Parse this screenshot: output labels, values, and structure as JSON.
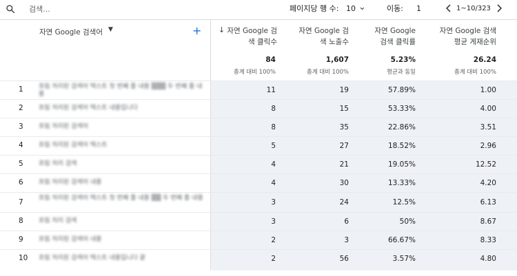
{
  "search": {
    "placeholder": "검색..."
  },
  "pagination": {
    "rows_label": "페이지당 행 수:",
    "rows_value": "10",
    "goto_label": "이동:",
    "goto_value": "1",
    "range": "1~10/323"
  },
  "columns": {
    "query": "자연 Google 검색어",
    "clicks": [
      "자연 Google 검",
      "색 클릭수"
    ],
    "impressions": [
      "자연 Google 검",
      "색 노출수"
    ],
    "ctr": [
      "자연 Google",
      "검색 클릭률"
    ],
    "position": [
      "자연 Google 검색",
      "평균 게재순위"
    ]
  },
  "totals": {
    "clicks": "84",
    "clicks_sub": "총계 대비 100%",
    "impressions": "1,607",
    "impressions_sub": "총계 대비 100%",
    "ctr": "5.23%",
    "ctr_sub": "평균과 동일",
    "position": "26.24",
    "position_sub": "총계 대비 100%"
  },
  "rows": [
    {
      "n": "1",
      "query": "흐림 처리된 검색어 텍스트 첫 번째 줄 내용 ▒▒▒ 두 번째 줄 내용",
      "clicks": "11",
      "impressions": "19",
      "ctr": "57.89%",
      "position": "1.00"
    },
    {
      "n": "2",
      "query": "흐림 처리된 검색어 텍스트 내용입니다",
      "clicks": "8",
      "impressions": "15",
      "ctr": "53.33%",
      "position": "4.00"
    },
    {
      "n": "3",
      "query": "흐림 처리된 검색어",
      "clicks": "8",
      "impressions": "35",
      "ctr": "22.86%",
      "position": "3.51"
    },
    {
      "n": "4",
      "query": "흐림 처리된 검색어 텍스트",
      "clicks": "5",
      "impressions": "27",
      "ctr": "18.52%",
      "position": "2.96"
    },
    {
      "n": "5",
      "query": "흐림 처리 검색",
      "clicks": "4",
      "impressions": "21",
      "ctr": "19.05%",
      "position": "12.52"
    },
    {
      "n": "6",
      "query": "흐림 처리된 검색어 내용",
      "clicks": "4",
      "impressions": "30",
      "ctr": "13.33%",
      "position": "4.20"
    },
    {
      "n": "7",
      "query": "흐림 처리된 검색어 텍스트 첫 번째 줄 내용 ▒▒ 두 번째 줄 내용",
      "clicks": "3",
      "impressions": "24",
      "ctr": "12.5%",
      "position": "6.13"
    },
    {
      "n": "8",
      "query": "흐림 처리 검색",
      "clicks": "3",
      "impressions": "6",
      "ctr": "50%",
      "position": "8.67"
    },
    {
      "n": "9",
      "query": "흐림 처리된 검색어 내용",
      "clicks": "2",
      "impressions": "3",
      "ctr": "66.67%",
      "position": "8.33"
    },
    {
      "n": "10",
      "query": "흐림 처리된 검색어 텍스트 내용입니다 끝",
      "clicks": "2",
      "impressions": "56",
      "ctr": "3.57%",
      "position": "4.80"
    }
  ],
  "colors": {
    "shade": "#eef2f6",
    "accent": "#1a73e8",
    "divider": "#dadce0"
  }
}
